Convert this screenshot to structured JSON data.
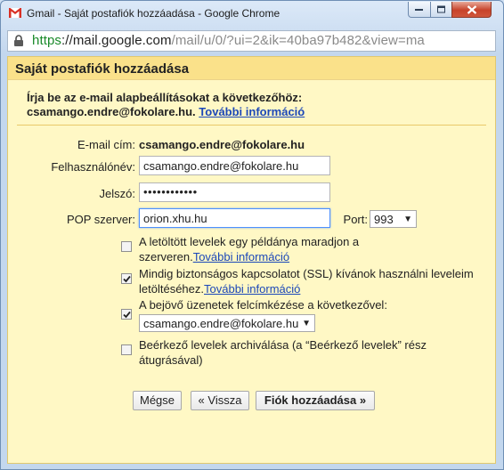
{
  "window": {
    "title": "Gmail - Saját postafiók hozzáadása - Google Chrome",
    "url_https": "https",
    "url_host": "://mail.google.com",
    "url_path": "/mail/u/0/?ui=2&ik=40ba97b482&view=ma"
  },
  "dialog": {
    "title": "Saját postafiók hozzáadása",
    "instruction_line1": "Írja be az e-mail alapbeállításokat a következőhöz:",
    "instruction_email": "csamango.endre@fokolare.hu.",
    "more_info_link": "További információ"
  },
  "form": {
    "email_label": "E-mail cím:",
    "email_value": "csamango.endre@fokolare.hu",
    "username_label": "Felhasználónév:",
    "username_value": "csamango.endre@fokolare.hu",
    "password_label": "Jelszó:",
    "password_value": "••••••••••••",
    "pop_label": "POP szerver:",
    "pop_value": "orion.xhu.hu",
    "port_label": "Port:",
    "port_value": "993"
  },
  "options": [
    {
      "text1": "A letöltött levelek egy példánya maradjon a",
      "text2": "szerveren.",
      "link": "További információ",
      "checked": false
    },
    {
      "text1": "Mindig biztonságos kapcsolatot (SSL) kívánok használni leveleim",
      "text2": "letöltéséhez.",
      "link": "További információ",
      "checked": true
    },
    {
      "text1": "A bejövő üzenetek felcímkézése a következővel:",
      "label_select": "csamango.endre@fokolare.hu",
      "checked": true
    },
    {
      "text1": "Beérkező levelek archiválása (a “Beérkező levelek” rész",
      "text2": "átugrásával)",
      "checked": false
    }
  ],
  "buttons": {
    "cancel": "Mégse",
    "back": "« Vissza",
    "add": "Fiók hozzáadása »"
  }
}
